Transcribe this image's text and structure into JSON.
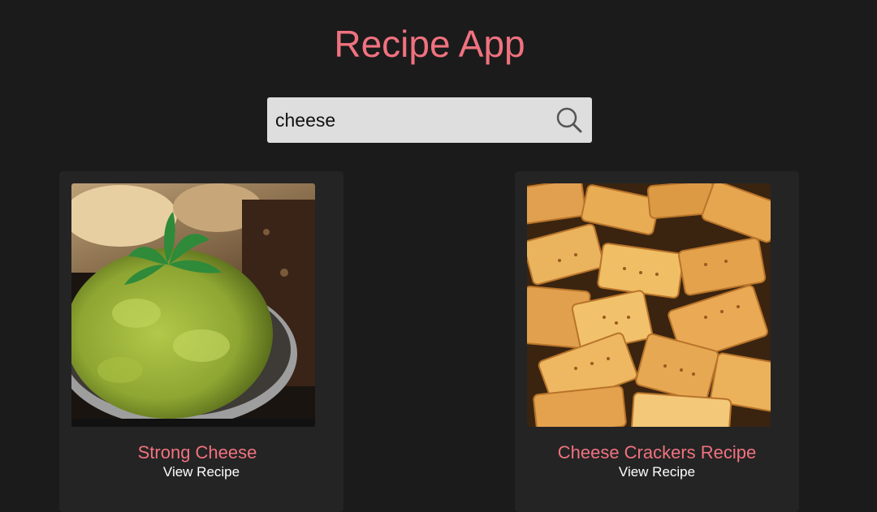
{
  "header": {
    "title": "Recipe App"
  },
  "search": {
    "value": "cheese",
    "icon": "search-icon"
  },
  "results": [
    {
      "title": "Strong Cheese",
      "link_label": "View Recipe",
      "image": "green cheese spread in bowl with parsley"
    },
    {
      "title": "Cheese Crackers Recipe",
      "link_label": "View Recipe",
      "image": "pile of square cheese crackers"
    }
  ],
  "colors": {
    "background": "#1b1b1b",
    "card": "#242424",
    "accent": "#f0727f",
    "search_bg": "#dedede"
  }
}
